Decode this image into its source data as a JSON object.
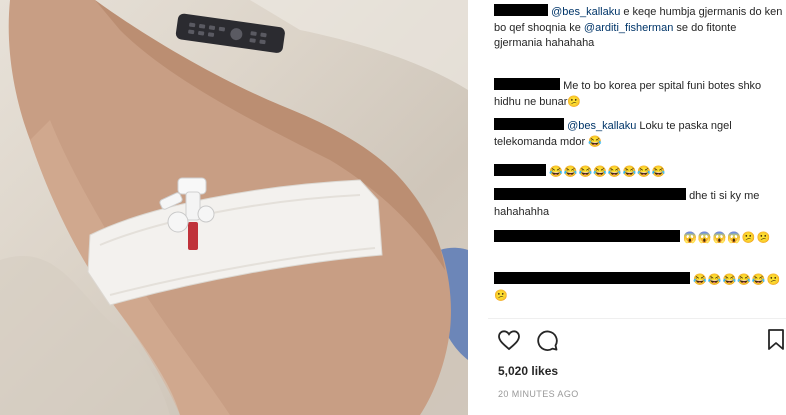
{
  "comments": [
    {
      "text_a": "@bes_kallaku",
      "text_b": " e keqe humbja gjermanis do ken bo qef shoqnia ke ",
      "text_c": "@arditi_fisherman",
      "text_d": " se do fitonte gjermania hahahaha"
    },
    {
      "text": "Me to bo korea per spital funi botes shko hidhu ne bunar",
      "emoji": "😕"
    },
    {
      "mention": "@bes_kallaku",
      "text": " Loku te paska ngel telekomanda mdor ",
      "emoji": "😂"
    },
    {
      "emoji": "😂😂😂😂😂😂😂😂"
    },
    {
      "text": "dhe ti si ky me hahahahha"
    },
    {
      "emoji": "😱😱😱😱😕😕"
    },
    {
      "emoji": "😂😂😂😂😂😕😕"
    }
  ],
  "likes": "5,020 likes",
  "time": "20 MINUTES AGO",
  "icons": {
    "like": "heart-icon",
    "comment": "comment-icon",
    "save": "bookmark-icon"
  }
}
